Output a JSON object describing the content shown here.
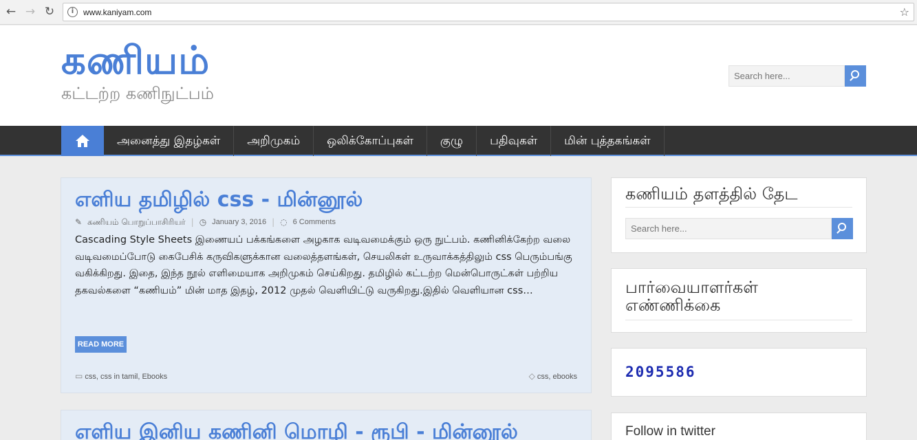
{
  "browser": {
    "url": "www.kaniyam.com",
    "icons": [
      "back-icon",
      "forward-icon",
      "reload-icon",
      "info-icon",
      "star-icon"
    ]
  },
  "header": {
    "site_title": "கணியம்",
    "tagline": "கட்டற்ற கணிநுட்பம்",
    "search_placeholder": "Search here..."
  },
  "nav": {
    "items": [
      "அனைத்து இதழ்கள்",
      "அறிமுகம்",
      "ஒலிக்கோப்புகள்",
      "குழு",
      "பதிவுகள்",
      "மின் புத்தகங்கள்"
    ]
  },
  "posts": [
    {
      "title": "எளிய தமிழில் css - மின்னூல்",
      "author": "கணியம் பொறுப்பாசிரியர்",
      "date": "January 3, 2016",
      "comments": "6 Comments",
      "excerpt": "Cascading Style Sheets இணையப் பக்கங்களை அழகாக வடிவமைக்கும் ஒரு நுட்பம். கணினிக்கேற்ற வலை வடிவமைப்போடு கைபேசிக் கருவிகளுக்கான வலைத்தளங்கள், செயலிகள் உருவாக்கத்திலும் css பெரும்பங்கு வகிக்கிறது. இதை, இந்த நூல் எளிமையாக அறிமுகம் செய்கிறது. தமிழில் கட்டற்ற மென்பொருட்கள் பற்றிய தகவல்களை “கணியம்” மின் மாத இதழ், 2012 முதல் வெளியிட்டு வருகிறது.இதில் வெளியான css…",
      "read_more": "READ MORE",
      "categories": "css, css in tamil, Ebooks",
      "tags": "css, ebooks"
    },
    {
      "title": "எளிய இனிய கணினி மொழி - ரூபி - மின்னூல்"
    }
  ],
  "sidebar": {
    "search_title": "கணியம் தளத்தில் தேட",
    "search_placeholder": "Search here...",
    "visitors_title": "பார்வையாளர்கள் எண்ணிக்கை",
    "visitor_count": "2095586",
    "twitter_title": "Follow in twitter"
  },
  "colors": {
    "accent": "#4a7fd6",
    "nav_bg": "#333333",
    "post_bg": "#e4ecf6",
    "counter": "#1c2bb0"
  }
}
